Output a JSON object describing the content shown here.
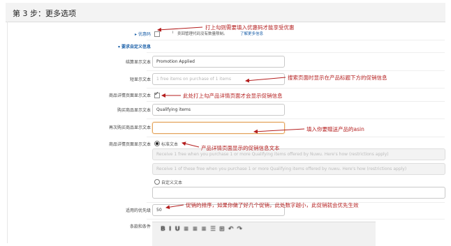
{
  "header": {
    "title": "第 3 步：更多选项"
  },
  "fields": {
    "promo_code": {
      "label": "优惠码",
      "hint_prefix": "i",
      "hint": "卖回管理代码没有数量限制。",
      "hint_link": "了解更多信息"
    },
    "custom_section": {
      "label": "要求自定义信息"
    },
    "checkout_display": {
      "label": "结算显示文本",
      "value": "Promotion Applied"
    },
    "short_display": {
      "label": "短显示文本",
      "placeholder": "1 free items on purchase of 1 items"
    },
    "detail_page_checkbox": {
      "label": "商品详情页面显示文本"
    },
    "qualifying_items": {
      "label": "购买商品显示文本",
      "value": "Qualifying items"
    },
    "purchased_items": {
      "label": "再次购买商品显示文本",
      "value": ""
    },
    "detail_page_text": {
      "label": "商品详情页面显示文本",
      "standard_label": "标准文本",
      "line1": "Receive 1 free when you purchase 1 or more Qualifying items offered by Nuwu. Here's how (restrictions apply)",
      "line2": "Receive 1 of these free when you purchase 1 or more Qualifying items offered by nuwu. Here's how (restrictions apply)",
      "custom_label": "自定义文本"
    },
    "priority": {
      "label": "适用的优先级",
      "value": "50"
    },
    "terms": {
      "label": "条款和条件"
    }
  },
  "annotations": {
    "a1": "打上勾则需要填入优惠码才能享受优惠",
    "a2": "搜索页面时显示在产品标题下方的促销信息",
    "a3": "此处打上勾产品详情页面才会显示促销信息",
    "a4": "填入你要赠送产品的asin",
    "a5": "产品详情页面显示的促销信息文本",
    "a6": "促销的排序，如果你做了好几个促销，此处数字越小，此促销就会优先生效"
  },
  "colors": {
    "annotation": "#b41e1e",
    "link": "#1a5fa8",
    "focus": "#e3a25a"
  }
}
